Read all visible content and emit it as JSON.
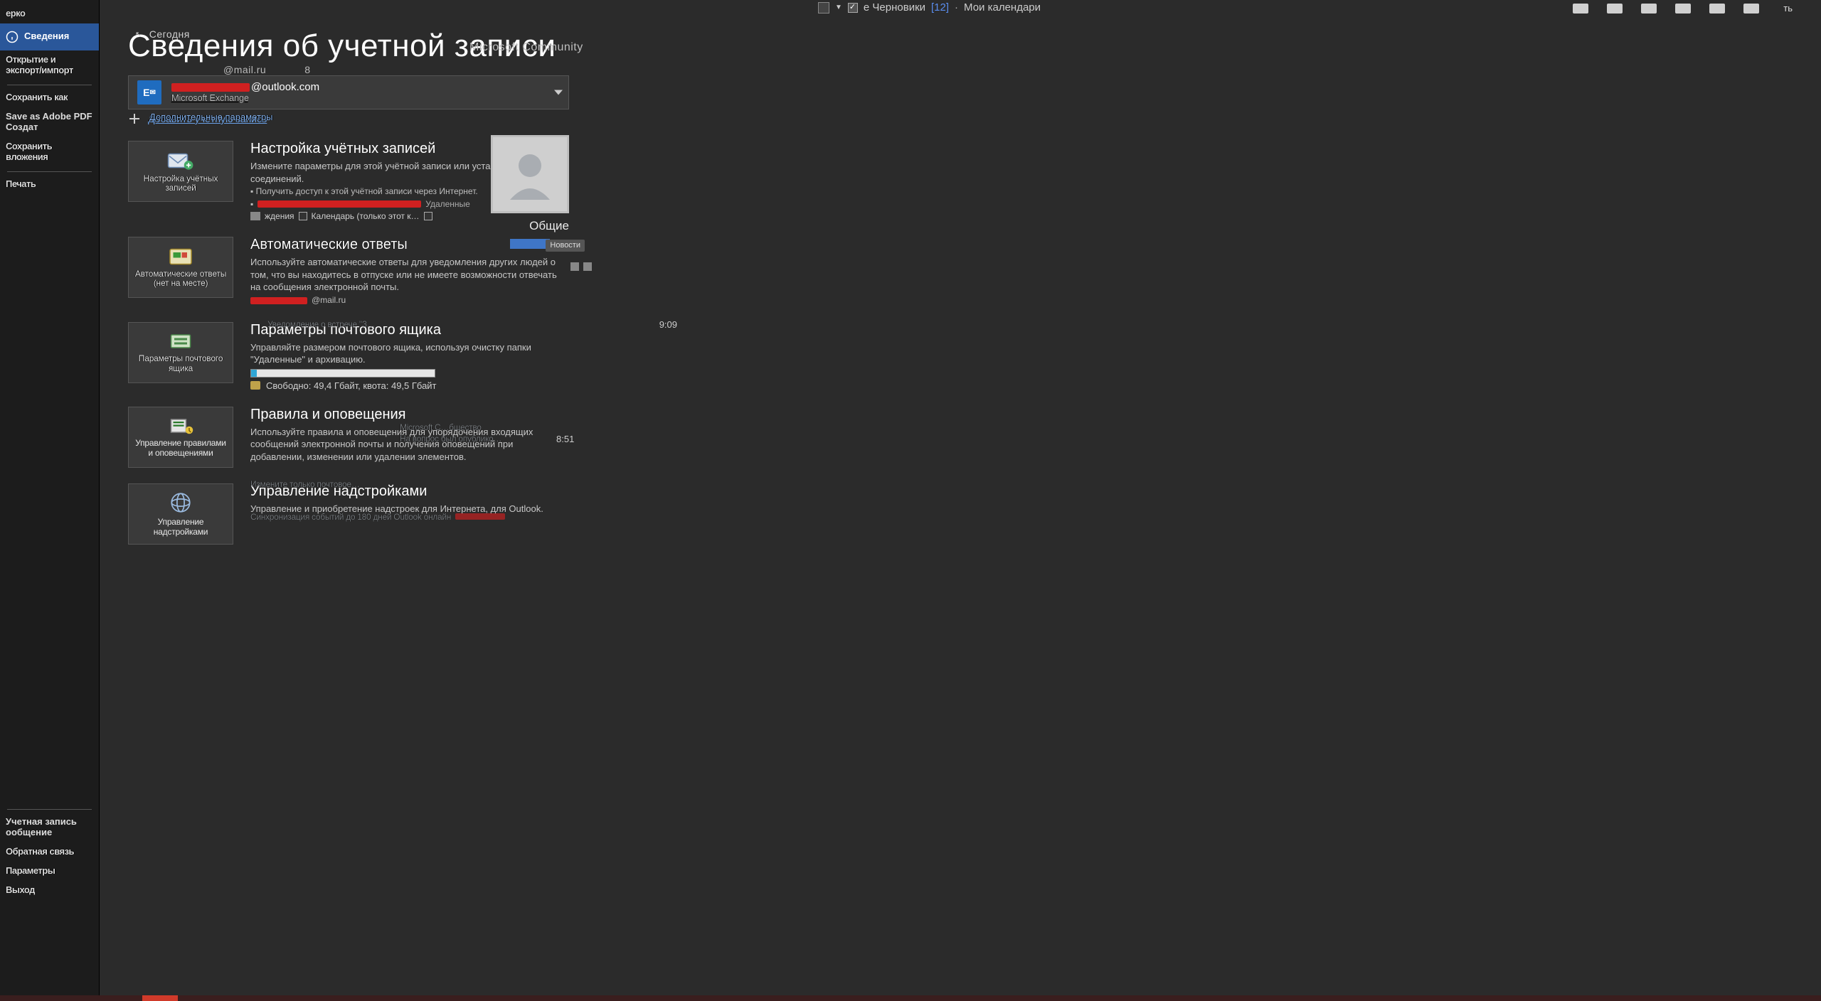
{
  "top_mid": {
    "label": "е Черновики",
    "count": "[12]",
    "cal": "Мои календари"
  },
  "topticks_txt": "ть",
  "leftnav": {
    "items": [
      {
        "label": "ерко"
      },
      {
        "label": "Сведения",
        "active": true
      },
      {
        "label": "Открытие и экспорт/импорт"
      },
      {
        "label": "Сохранить как"
      },
      {
        "label": "Save as Adobe PDF    Создат"
      },
      {
        "label": "Сохранить вложения"
      },
      {
        "label": "Печать"
      }
    ],
    "footer": [
      {
        "label": "Учетная запись   ообщение"
      },
      {
        "label": "Обратная связь"
      },
      {
        "label": "Параметры"
      },
      {
        "label": "Выход"
      }
    ]
  },
  "title": "Сведения об учетной записи",
  "title_overlay": {
    "today": "Сегодня",
    "mail": "@mail.ru",
    "num": "8",
    "ms": "Microsoft Community"
  },
  "account": {
    "addr_suffix": "@outlook.com",
    "type": "Microsoft Exchange"
  },
  "add_account": {
    "label": "Добавить учётную запись",
    "ghost": "Дополнительные параметры"
  },
  "sections": [
    {
      "tile": "Настройка учётных записей",
      "title": "Настройка учётных записей",
      "desc": "Измените параметры для этой учётной записи или установите больше соединений.",
      "sub1": "Получить доступ к этой учётной записи через Интернет.",
      "chk1_label": "ждения",
      "chk2_label": "Календарь (только этот к…",
      "avatar_caption": "Общие",
      "ghost_right": "Удаленные"
    },
    {
      "tile": "Автоматические ответы\n(нет на месте)",
      "title": "Автоматические ответы",
      "desc": "Используйте автоматические ответы для уведомления других людей о том, что вы находитесь в отпуске или не имеете возможности отвечать на сообщения электронной почты.",
      "ghost_tag": "Новости",
      "mail_ghost": "@mail.ru"
    },
    {
      "tile": "Параметры почтового ящика",
      "title": "Параметры почтового ящика",
      "desc": "Управляйте размером почтового ящика, используя очистку папки \"Удаленные\" и архивацию.",
      "storage": "Свободно: 49,4 Гбайт, квота: 49,5 Гбайт",
      "ghost_time": "9:09",
      "ghost_line": "Уведомление о встрече \"З…"
    },
    {
      "tile": "Управление правилами и оповещениями",
      "title": "Правила и оповещения",
      "desc": "Используйте правила и оповещения для упорядочения входящих сообщений электронной почты и получения оповещений при добавлении, изменении или удалении элементов.",
      "ghost_right": "Microsoft C…бщество",
      "ghost_under": "На вопрос был опублико…",
      "ghost_time": "8:51"
    },
    {
      "tile": "Управление надстройками",
      "title": "Управление надстройками",
      "desc": "Управление и приобретение надстроек для Интернета, для Outlook.",
      "sub": "Измените только почтовое…",
      "sub2": "Синхронизация событий до 180 дней Outlook      онлайн"
    }
  ]
}
